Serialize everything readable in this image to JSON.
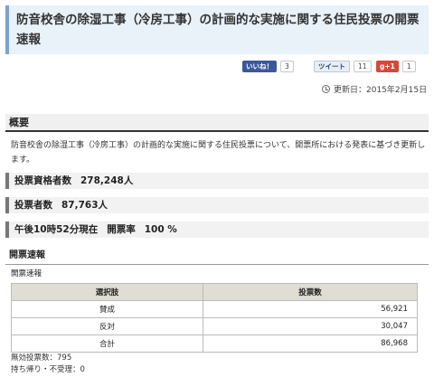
{
  "title": "防音校舎の除湿工事（冷房工事）の計画的な実施に関する住民投票の開票速報",
  "social": {
    "facebook_label": "いいね！",
    "facebook_count": "3",
    "twitter_label": "ツイート",
    "twitter_count": "11",
    "gplus_label": "g+1",
    "gplus_count": "1"
  },
  "updated": "更新日：2015年2月15日",
  "overview": {
    "heading": "概要",
    "text": "防音校舎の除湿工事（冷房工事）の計画的な実施に関する住民投票について、開票所における発表に基づき更新します。"
  },
  "stats": {
    "eligible_label": "投票資格者数",
    "eligible_value": "278,248人",
    "voters_label": "投票者数",
    "voters_value": "87,763人",
    "time_label": "午後10時52分現在",
    "rate_label": "開票率",
    "rate_value": "100 %"
  },
  "results": {
    "heading": "開票速報",
    "sub_heading": "開票速報",
    "columns": [
      "選択肢",
      "投票数"
    ],
    "rows": [
      {
        "choice": "賛成",
        "votes": "56,921"
      },
      {
        "choice": "反対",
        "votes": "30,047"
      },
      {
        "choice": "合計",
        "votes": "86,968"
      }
    ]
  },
  "footer": {
    "invalid": "無効投票数：795",
    "other": "持ち帰り・不受理：0"
  }
}
